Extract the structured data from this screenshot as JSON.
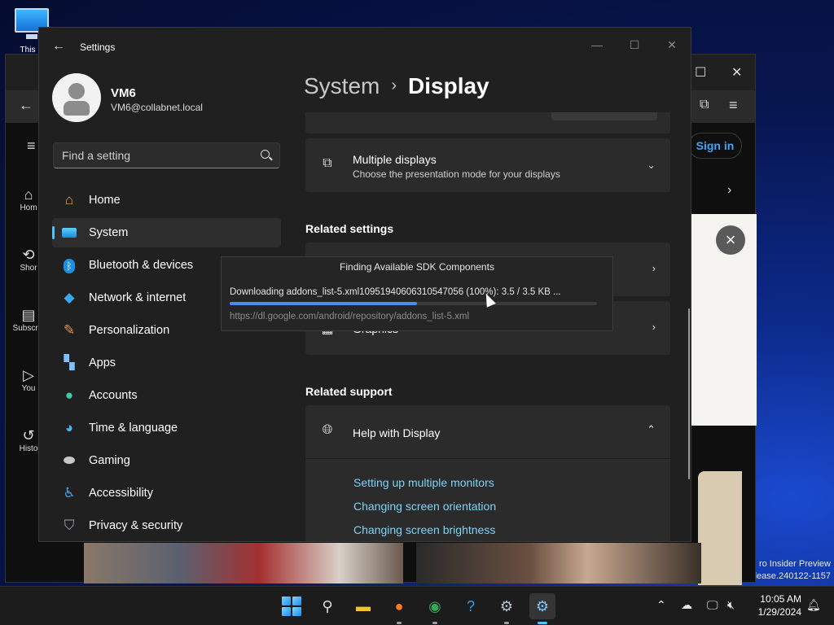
{
  "desktop": {
    "icon_label": "This D",
    "watermark_line1": "ro Insider Preview",
    "watermark_line2": "lease.240122-1157"
  },
  "browser": {
    "sign_in": "Sign in",
    "nav": [
      "Hom",
      "Shor",
      "Subscrip",
      "You",
      "Histo"
    ]
  },
  "settings": {
    "app_title": "Settings",
    "user": {
      "name": "VM6",
      "email": "VM6@collabnet.local"
    },
    "search": {
      "placeholder": "Find a setting"
    },
    "nav": [
      {
        "label": "Home",
        "icon": "home-icon"
      },
      {
        "label": "System",
        "icon": "system-icon"
      },
      {
        "label": "Bluetooth & devices",
        "icon": "bluetooth-icon"
      },
      {
        "label": "Network & internet",
        "icon": "wifi-icon"
      },
      {
        "label": "Personalization",
        "icon": "brush-icon"
      },
      {
        "label": "Apps",
        "icon": "apps-icon"
      },
      {
        "label": "Accounts",
        "icon": "person-icon"
      },
      {
        "label": "Time & language",
        "icon": "globe-clock-icon"
      },
      {
        "label": "Gaming",
        "icon": "controller-icon"
      },
      {
        "label": "Accessibility",
        "icon": "accessibility-icon"
      },
      {
        "label": "Privacy & security",
        "icon": "shield-icon"
      }
    ],
    "active_nav": "System",
    "breadcrumb": {
      "parent": "System",
      "separator": "›",
      "current": "Display"
    },
    "multiple_displays": {
      "title": "Multiple displays",
      "subtitle": "Choose the presentation mode for your displays"
    },
    "related_settings": {
      "heading": "Related settings",
      "graphics_label": "Graphics"
    },
    "related_support": {
      "heading": "Related support",
      "help_title": "Help with Display",
      "links": [
        "Setting up multiple monitors",
        "Changing screen orientation",
        "Changing screen brightness"
      ]
    }
  },
  "sdk_dialog": {
    "title": "Finding Available SDK Components",
    "status": "Downloading addons_list-5.xml10951940606310547056 (100%): 3.5 / 3.5 KB ...",
    "url": "https://dl.google.com/android/repository/addons_list-5.xml",
    "progress": 0.51
  },
  "taskbar": {
    "apps": [
      "start",
      "search",
      "file-explorer",
      "firefox",
      "chrome",
      "help",
      "settings",
      "android-studio"
    ],
    "active_app": "android-studio",
    "time": "10:05 AM",
    "date": "1/29/2024"
  },
  "colors": {
    "accent": "#4cc2ff",
    "link": "#7dd3f7",
    "progress": "#4d8bf0"
  }
}
